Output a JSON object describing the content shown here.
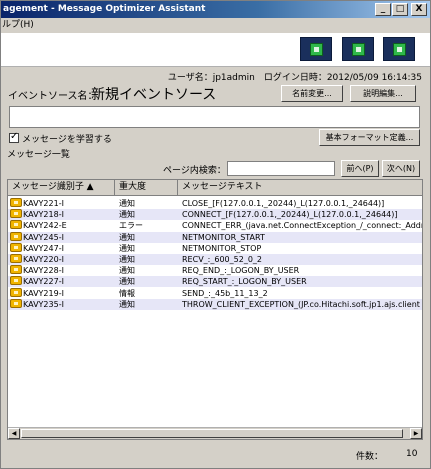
{
  "window": {
    "title": "agement - Message Optimizer Assistant",
    "min": "_",
    "max": "□",
    "close": "X"
  },
  "menubar": {
    "help": "ルプ(H)"
  },
  "toolbar": {
    "icons": [
      "tool-icon-1",
      "tool-icon-2",
      "tool-icon-3"
    ]
  },
  "user": {
    "info": "ユーザ名：jp1admin　ログイン日時：2012/05/09 16:14:35"
  },
  "source": {
    "label": "イベントソース名：",
    "name": "新規イベントソース",
    "rename_button": "名前変更...",
    "desc_button": "説明編集..."
  },
  "learn": {
    "label": "メッセージを学習する",
    "checked": true
  },
  "format_button": "基本フォーマット定義...",
  "list_label": "メッセージ一覧",
  "search": {
    "label": "ページ内検索：",
    "prev": "前へ(P)",
    "next": "次へ(N)"
  },
  "table": {
    "headers": [
      "メッセージ識別子 ▲",
      "重大度",
      "メッセージテキスト"
    ],
    "rows": [
      {
        "id": "KAVY221-I",
        "sev": "通知",
        "text": "CLOSE_[F(127.0.0.1,_20244)_L(127.0.0.1,_24644)]"
      },
      {
        "id": "KAVY218-I",
        "sev": "通知",
        "text": "CONNECT_[F(127.0.0.1,_20244)_L(127.0.0.1,_24644)]"
      },
      {
        "id": "KAVY242-E",
        "sev": "エラー",
        "text": "CONNECT_ERR_(java.net.ConnectException_/_connect:_Address"
      },
      {
        "id": "KAVY245-I",
        "sev": "通知",
        "text": "NETMONITOR_START"
      },
      {
        "id": "KAVY247-I",
        "sev": "通知",
        "text": "NETMONITOR_STOP"
      },
      {
        "id": "KAVY220-I",
        "sev": "通知",
        "text": "RECV_:_600_52_0_2"
      },
      {
        "id": "KAVY228-I",
        "sev": "通知",
        "text": "REQ_END_:_LOGON_BY_USER"
      },
      {
        "id": "KAVY227-I",
        "sev": "通知",
        "text": "REQ_START_:_LOGON_BY_USER"
      },
      {
        "id": "KAVY219-I",
        "sev": "情報",
        "text": "SEND_:_45b_11_13_2"
      },
      {
        "id": "KAVY235-I",
        "sev": "通知",
        "text": "THROW_CLIENT_EXCEPTION_(JP.co.Hitachi.soft.jp1.ajs.client"
      }
    ]
  },
  "scroll": {
    "left": "◀",
    "right": "▶"
  },
  "footer": {
    "count_label": "件数：",
    "count": "10"
  },
  "colors": {
    "title_start": "#0a246a",
    "row_alt": "#e6e6f7",
    "tool_bg": "#1a2f5c",
    "tool_icon": "#2fb84a"
  }
}
